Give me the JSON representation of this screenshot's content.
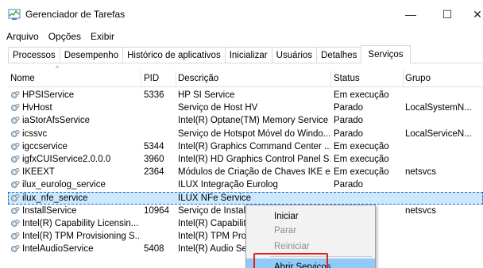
{
  "window": {
    "title": "Gerenciador de Tarefas",
    "minimize_symbol": "—",
    "maximize_symbol": "☐",
    "close_symbol": "✕"
  },
  "menu": [
    "Arquivo",
    "Opções",
    "Exibir"
  ],
  "tabs": [
    {
      "label": "Processos",
      "active": false
    },
    {
      "label": "Desempenho",
      "active": false
    },
    {
      "label": "Histórico de aplicativos",
      "active": false
    },
    {
      "label": "Inicializar",
      "active": false
    },
    {
      "label": "Usuários",
      "active": false
    },
    {
      "label": "Detalhes",
      "active": false
    },
    {
      "label": "Serviços",
      "active": true
    }
  ],
  "columns": {
    "name": "Nome",
    "pid": "PID",
    "description": "Descrição",
    "status": "Status",
    "group": "Grupo"
  },
  "sort_indicator": "^",
  "rows": [
    {
      "name": "HPSIService",
      "pid": "5336",
      "description": "HP SI Service",
      "status": "Em execução",
      "group": ""
    },
    {
      "name": "HvHost",
      "pid": "",
      "description": "Serviço de Host HV",
      "status": "Parado",
      "group": "LocalSystemN..."
    },
    {
      "name": "iaStorAfsService",
      "pid": "",
      "description": "Intel(R) Optane(TM) Memory Service",
      "status": "Parado",
      "group": ""
    },
    {
      "name": "icssvc",
      "pid": "",
      "description": "Serviço de Hotspot Móvel do Windo...",
      "status": "Parado",
      "group": "LocalServiceN..."
    },
    {
      "name": "igccservice",
      "pid": "5344",
      "description": "Intel(R) Graphics Command Center ...",
      "status": "Em execução",
      "group": ""
    },
    {
      "name": "igfxCUIService2.0.0.0",
      "pid": "3960",
      "description": "Intel(R) HD Graphics Control Panel S...",
      "status": "Em execução",
      "group": ""
    },
    {
      "name": "IKEEXT",
      "pid": "2364",
      "description": "Módulos de Criação de Chaves IKE e...",
      "status": "Em execução",
      "group": "netsvcs"
    },
    {
      "name": "ilux_eurolog_service",
      "pid": "",
      "description": "ILUX Integração Eurolog",
      "status": "Parado",
      "group": ""
    },
    {
      "name": "ilux_nfe_service",
      "pid": "",
      "description": "ILUX NFe Service",
      "status": "",
      "group": "",
      "selected": true
    },
    {
      "name": "InstallService",
      "pid": "10964",
      "description": "Serviço de Instala",
      "status": "ão",
      "group": "netsvcs"
    },
    {
      "name": "Intel(R) Capability Licensin...",
      "pid": "",
      "description": "Intel(R) Capability",
      "status": "",
      "group": ""
    },
    {
      "name": "Intel(R) TPM Provisioning S...",
      "pid": "",
      "description": "Intel(R) TPM Prov",
      "status": "",
      "group": ""
    },
    {
      "name": "IntelAudioService",
      "pid": "5408",
      "description": "Intel(R) Audio Ser",
      "status": "ão",
      "group": ""
    }
  ],
  "context_menu": [
    {
      "label": "Iniciar",
      "disabled": false
    },
    {
      "label": "Parar",
      "disabled": true
    },
    {
      "label": "Reiniciar",
      "disabled": true
    },
    {
      "label": "Abrir Serviços",
      "disabled": false,
      "highlighted": true
    }
  ],
  "colors": {
    "selection": "#cce8ff",
    "menu_hover": "#91c9f7",
    "callout": "#e02020"
  },
  "icons": {
    "app": "task-manager-icon",
    "service": "service-gear-icon"
  }
}
